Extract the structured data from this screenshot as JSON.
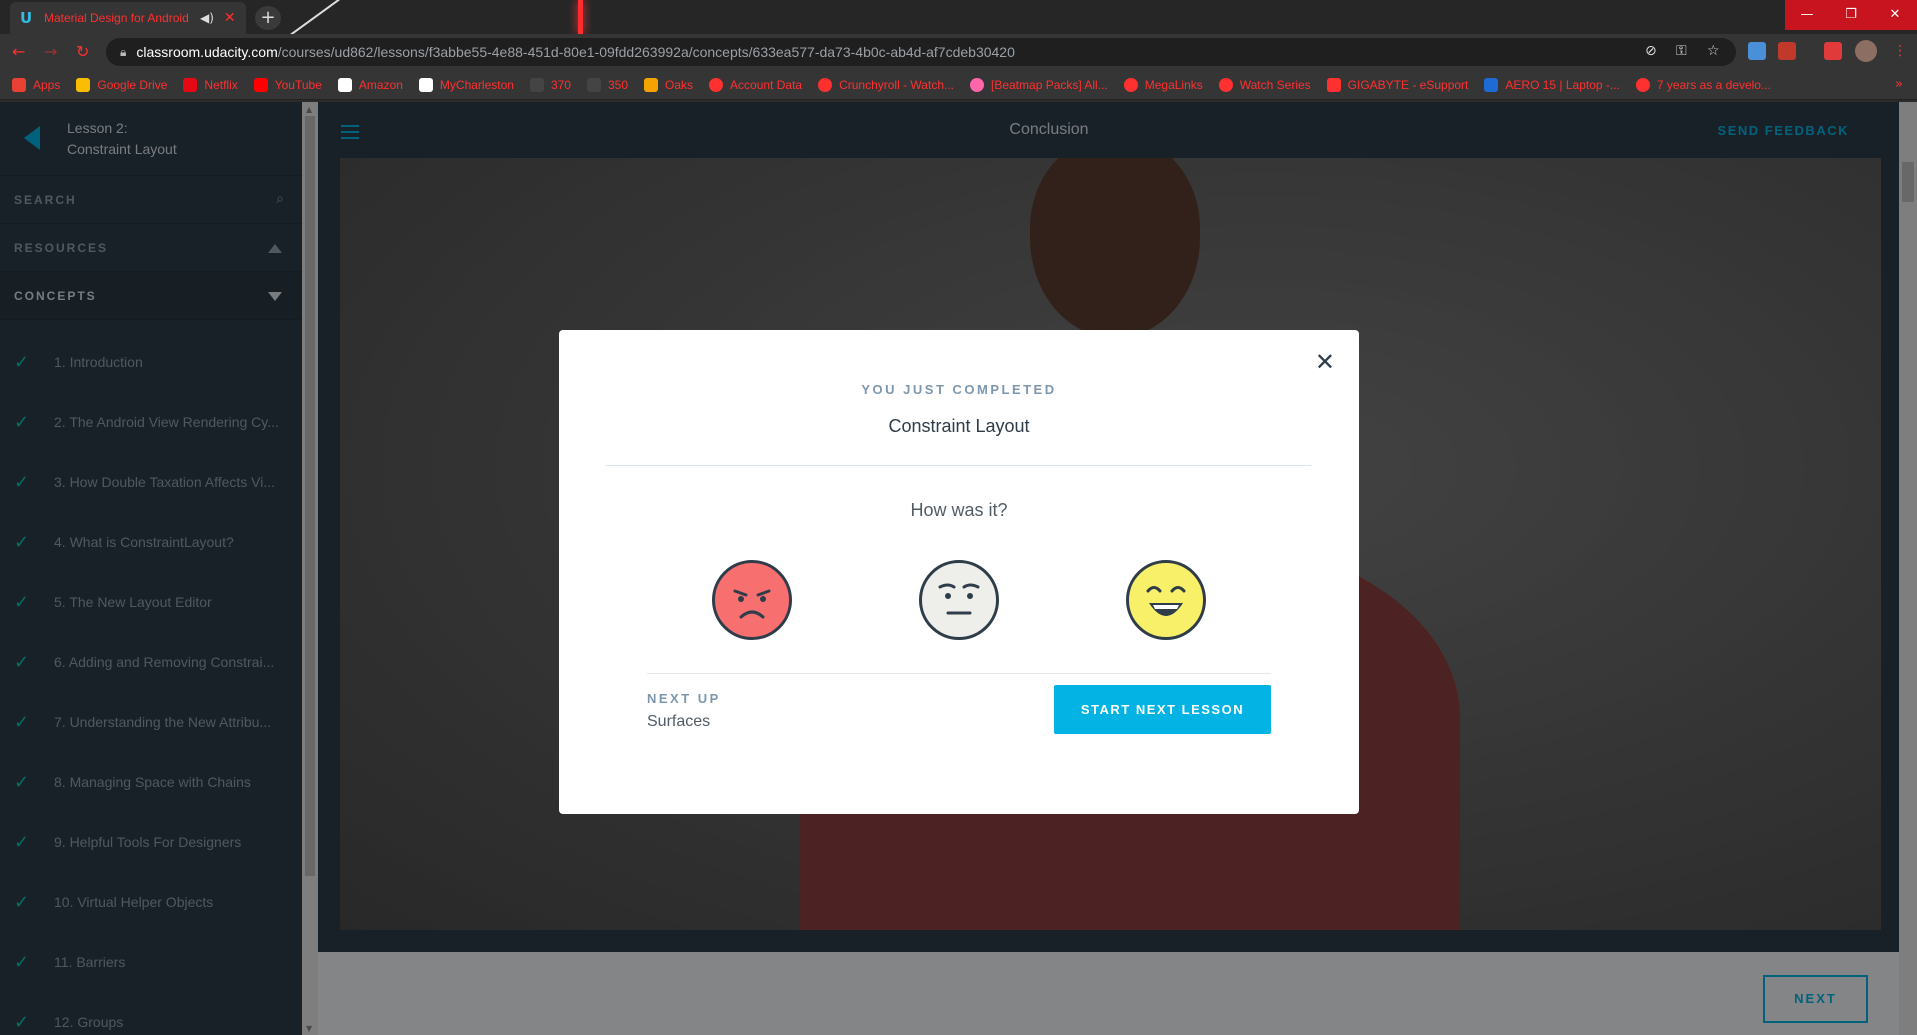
{
  "browser": {
    "tab_title": "Material Design for Android",
    "url_host": "classroom.udacity.com",
    "url_path": "/courses/ud862/lessons/f3abbe55-4e88-451d-80e1-09fdd263992a/concepts/633ea577-da73-4b0c-ab4d-af7cdeb30420",
    "bookmarks": [
      {
        "label": "Apps",
        "color": "#e94235"
      },
      {
        "label": "Google Drive",
        "color": "#fbbc04"
      },
      {
        "label": "Netflix",
        "color": "#e50914"
      },
      {
        "label": "YouTube",
        "color": "#ff0000"
      },
      {
        "label": "Amazon",
        "color": "#ffffff"
      },
      {
        "label": "MyCharleston",
        "color": "#ffffff"
      },
      {
        "label": "370",
        "color": "#444444"
      },
      {
        "label": "350",
        "color": "#444444"
      },
      {
        "label": "Oaks",
        "color": "#f4a300"
      },
      {
        "label": "Account Data",
        "color": "#ff3030"
      },
      {
        "label": "Crunchyroll - Watch...",
        "color": "#ff3030"
      },
      {
        "label": "[Beatmap Packs] All...",
        "color": "#ff66aa"
      },
      {
        "label": "MegaLinks",
        "color": "#ff3030"
      },
      {
        "label": "Watch Series",
        "color": "#ff3030"
      },
      {
        "label": "GIGABYTE - eSupport",
        "color": "#ff3030"
      },
      {
        "label": "AERO 15 | Laptop -...",
        "color": "#1e6bd6"
      },
      {
        "label": "7 years as a develo...",
        "color": "#ff3030"
      }
    ]
  },
  "sidebar": {
    "lesson_number": "Lesson 2:",
    "lesson_name": "Constraint Layout",
    "search_label": "SEARCH",
    "resources_label": "RESOURCES",
    "concepts_label": "CONCEPTS",
    "concepts": [
      "1. Introduction",
      "2. The Android View Rendering Cy...",
      "3. How Double Taxation Affects Vi...",
      "4. What is ConstraintLayout?",
      "5. The New Layout Editor",
      "6. Adding and Removing Constrai...",
      "7. Understanding the New Attribu...",
      "8. Managing Space with Chains",
      "9. Helpful Tools For Designers",
      "10. Virtual Helper Objects",
      "11. Barriers",
      "12. Groups"
    ]
  },
  "header": {
    "concept_title": "Conclusion",
    "feedback_label": "SEND FEEDBACK"
  },
  "footer": {
    "next_label": "NEXT"
  },
  "modal": {
    "completed_label": "YOU JUST COMPLETED",
    "lesson_name": "Constraint Layout",
    "rating_prompt": "How was it?",
    "faces": [
      {
        "name": "angry-face-icon",
        "color": "#f76f6f"
      },
      {
        "name": "neutral-face-icon",
        "color": "#eeeeea"
      },
      {
        "name": "happy-face-icon",
        "color": "#f9f06a"
      }
    ],
    "next_up_label": "NEXT UP",
    "next_up_lesson": "Surfaces",
    "start_button": "START NEXT LESSON"
  },
  "colors": {
    "accent": "#02b3e4",
    "check": "#02ccba",
    "sidebar_bg": "#2e3d49"
  }
}
